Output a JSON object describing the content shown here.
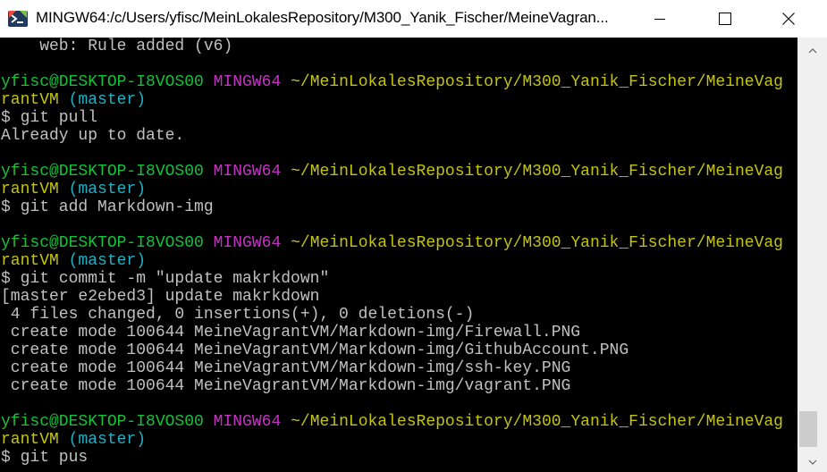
{
  "window": {
    "title": "MINGW64:/c/Users/yfisc/MeinLokalesRepository/M300_Yanik_Fischer/MeineVagran...",
    "app_icon": "mingw-terminal-icon",
    "controls": {
      "minimize_icon": "minimize-icon",
      "maximize_icon": "maximize-icon",
      "close_icon": "close-icon"
    }
  },
  "colors": {
    "user_host": "#13c23b",
    "msystem": "#c234c2",
    "path": "#c4c40f",
    "branch": "#22b0c4",
    "text": "#c0c0c0",
    "background": "#000000"
  },
  "terminal": {
    "line_0": "    web: Rule added (v6)",
    "line_1": "",
    "prompt_1": {
      "user_host": "yfisc@DESKTOP-I8VOS00",
      "msystem": "MINGW64",
      "path_start": "~/MeinLokalesRepository/M300_Yanik_Fischer/MeineVag",
      "path_end": "rantVM",
      "branch": "(master)",
      "command": "$ git pull"
    },
    "output_1": "Already up to date.",
    "prompt_2": {
      "user_host": "yfisc@DESKTOP-I8VOS00",
      "msystem": "MINGW64",
      "path_start": "~/MeinLokalesRepository/M300_Yanik_Fischer/MeineVag",
      "path_end": "rantVM",
      "branch": "(master)",
      "command": "$ git add Markdown-img"
    },
    "prompt_3": {
      "user_host": "yfisc@DESKTOP-I8VOS00",
      "msystem": "MINGW64",
      "path_start": "~/MeinLokalesRepository/M300_Yanik_Fischer/MeineVag",
      "path_end": "rantVM",
      "branch": "(master)",
      "command": "$ git commit -m \"update makrkdown\""
    },
    "output_3": [
      "[master e2ebed3] update makrkdown",
      " 4 files changed, 0 insertions(+), 0 deletions(-)",
      " create mode 100644 MeineVagrantVM/Markdown-img/Firewall.PNG",
      " create mode 100644 MeineVagrantVM/Markdown-img/GithubAccount.PNG",
      " create mode 100644 MeineVagrantVM/Markdown-img/ssh-key.PNG",
      " create mode 100644 MeineVagrantVM/Markdown-img/vagrant.PNG"
    ],
    "prompt_4": {
      "user_host": "yfisc@DESKTOP-I8VOS00",
      "msystem": "MINGW64",
      "path_start": "~/MeinLokalesRepository/M300_Yanik_Fischer/MeineVag",
      "path_end": "rantVM",
      "branch": "(master)",
      "command": "$ git pus"
    }
  },
  "scrollbar": {
    "up_icon": "scroll-up-arrow-icon",
    "down_icon": "scroll-down-arrow-icon"
  }
}
